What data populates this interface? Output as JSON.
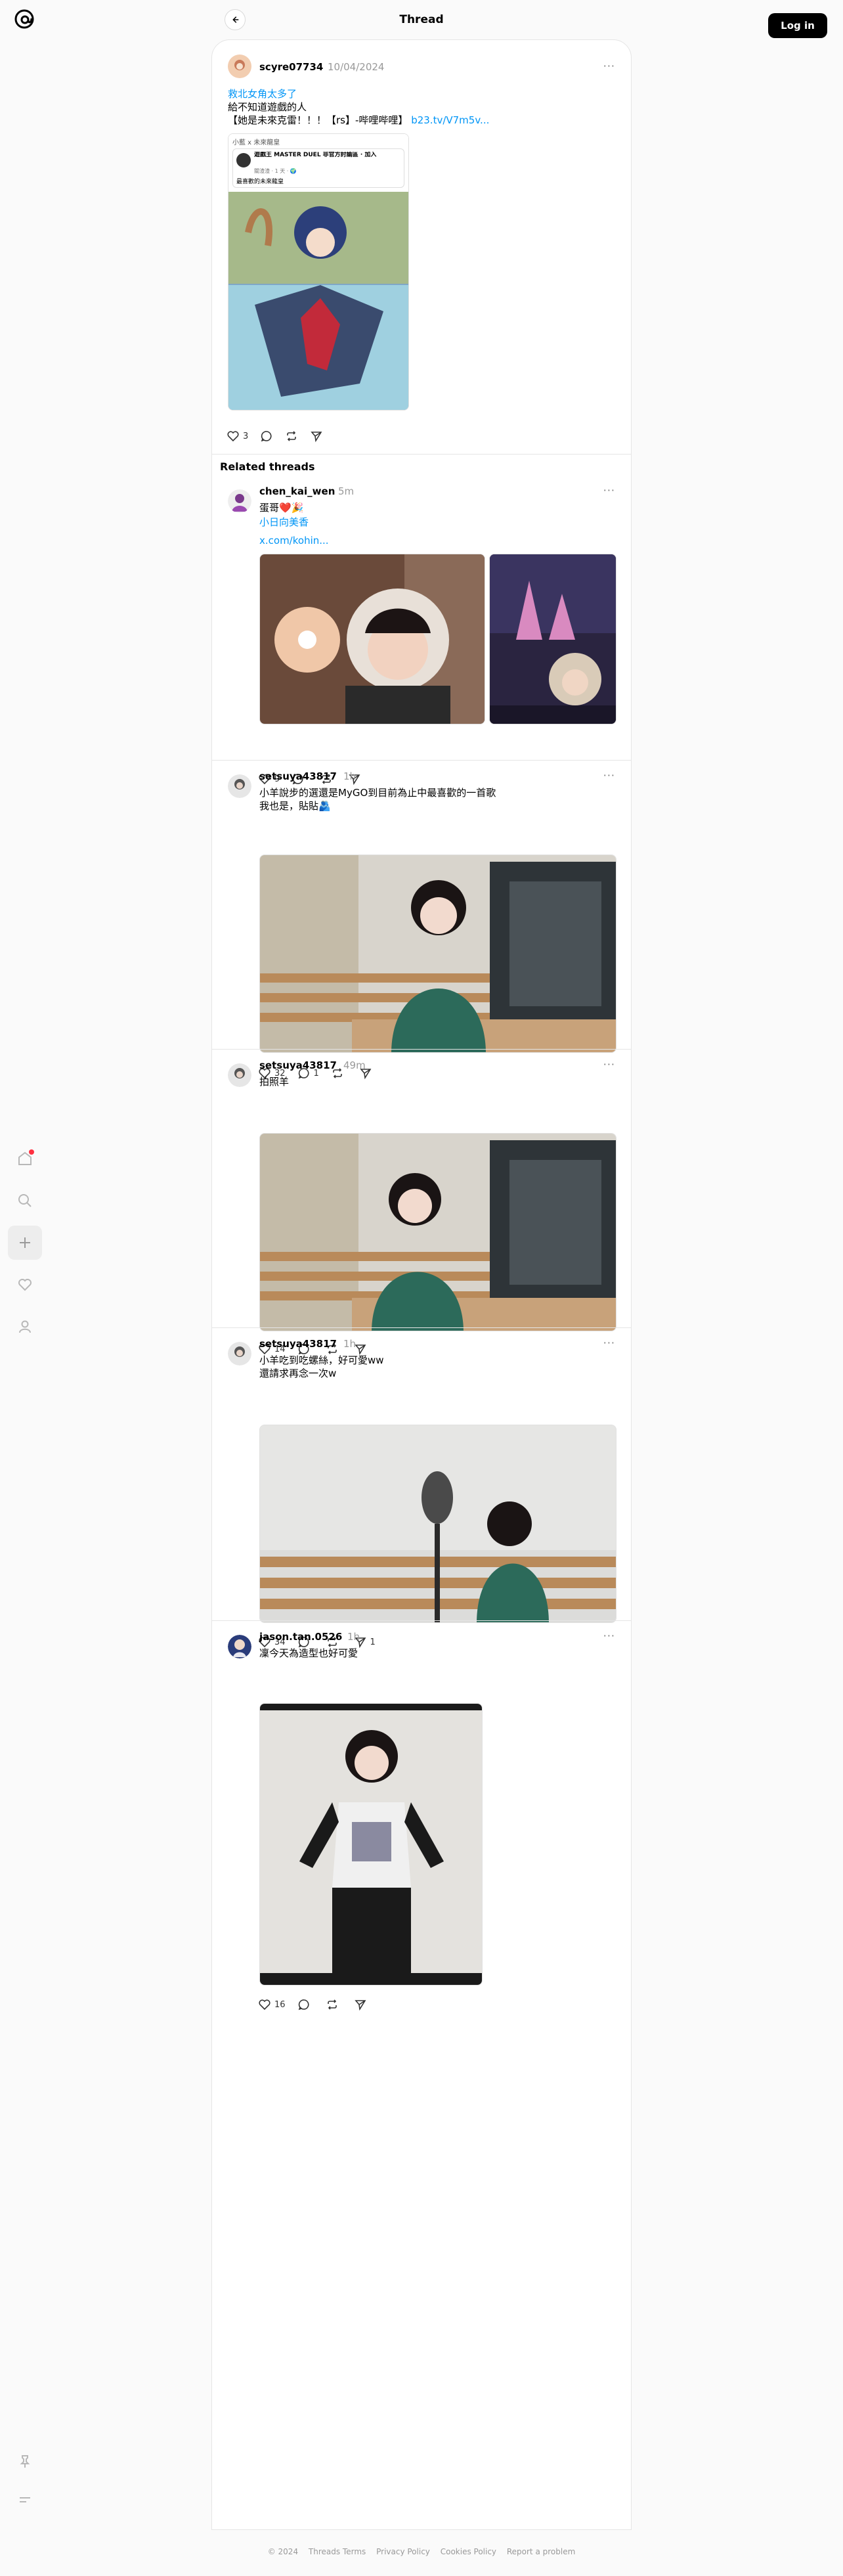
{
  "header": {
    "title": "Thread",
    "login_label": "Log in"
  },
  "sidebar": {
    "items": [
      {
        "name": "home-icon"
      },
      {
        "name": "search-icon"
      },
      {
        "name": "plus-icon"
      },
      {
        "name": "heart-icon"
      },
      {
        "name": "user-icon"
      },
      {
        "name": "pin-icon"
      },
      {
        "name": "menu-icon"
      }
    ],
    "notification_color": "#ff3040"
  },
  "main_post": {
    "username": "scyre07734",
    "time": "10/04/2024",
    "lines": [
      "救北女角太多了",
      "給不知道遊戲的人",
      "【她是未來克雷！！！【rs】-哔哩哔哩】"
    ],
    "link_text": "b23.tv/V7m5v...",
    "embed": {
      "top_text": "小藍 x 未來龍皇",
      "author": "遊戲王 MASTER DUEL 非官方討論區 · 加入",
      "author_meta": "關渣渣 · 1 天 · 🌍",
      "caption": "最喜歡的未來龍皇"
    },
    "likes": "3"
  },
  "related_heading": "Related threads",
  "related": [
    {
      "username": "chen_kai_wen",
      "time": "5m",
      "lines": [
        "蛋哥❤️🎉"
      ],
      "link_lines": [
        "小日向美香",
        "x.com/kohin..."
      ],
      "likes": "9",
      "replies": "",
      "reposts": "",
      "shares": ""
    },
    {
      "username": "setsuya43817",
      "time": "1h",
      "lines": [
        "小羊說步的選還是MyGO到目前為止中最喜歡的一首歌",
        "我也是，貼貼🫂"
      ],
      "link_lines": [],
      "likes": "32",
      "replies": "1",
      "reposts": "",
      "shares": ""
    },
    {
      "username": "setsuya43817",
      "time": "49m",
      "lines": [
        "拍照羊"
      ],
      "link_lines": [],
      "likes": "14",
      "replies": "",
      "reposts": "",
      "shares": ""
    },
    {
      "username": "setsuya43817",
      "time": "1h",
      "lines": [
        "小羊吃到吃螺絲，好可愛ww",
        "還請求再念一次w"
      ],
      "link_lines": [],
      "likes": "34",
      "replies": "",
      "reposts": "",
      "shares": "1"
    },
    {
      "username": "jason.tan.0526",
      "time": "1h",
      "lines": [
        "凜今天為造型也好可愛"
      ],
      "link_lines": [],
      "likes": "16",
      "replies": "",
      "reposts": "",
      "shares": ""
    }
  ],
  "more_label": "···",
  "footer": {
    "copyright": "© 2024",
    "links": [
      "Threads Terms",
      "Privacy Policy",
      "Cookies Policy",
      "Report a problem"
    ]
  }
}
